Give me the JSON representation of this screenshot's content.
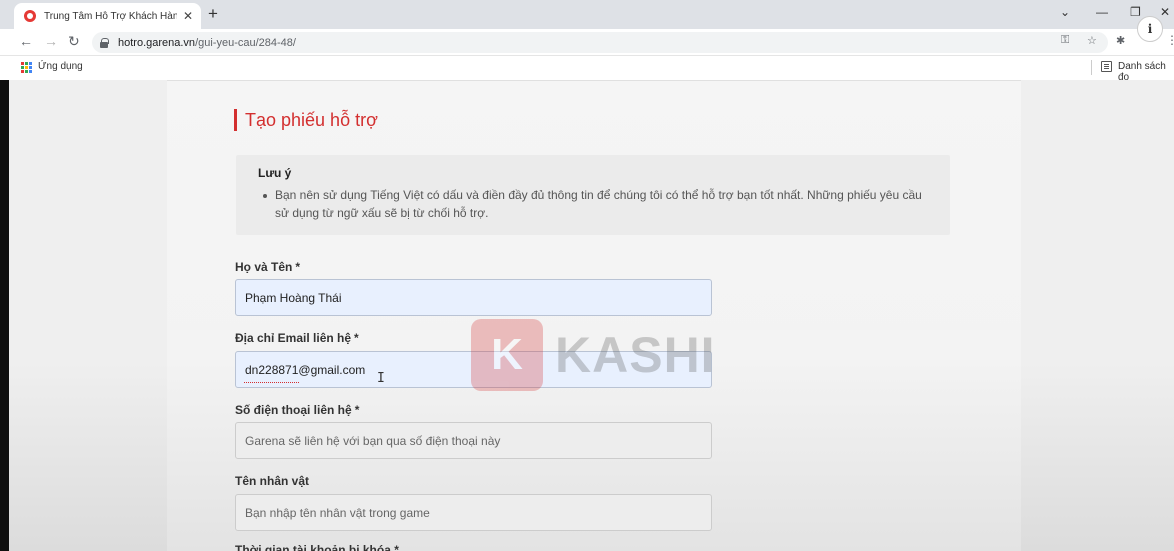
{
  "browser": {
    "tab_title": "Trung Tâm Hỗ Trợ Khách Hàng G",
    "tab_close": "✕",
    "new_tab": "+",
    "url_host": "hotro.garena.vn",
    "url_path": "/gui-yeu-cau/284-48/",
    "bookmark_apps": "Ứng dụng",
    "bookmark_reading_list": "Danh sách đọ",
    "profile_glyph": "i"
  },
  "page": {
    "title": "Tạo phiếu hỗ trợ",
    "note_title": "Lưu ý",
    "note_text": "Bạn nên sử dụng Tiếng Việt có dấu và điền đầy đủ thông tin để chúng tôi có thể hỗ trợ bạn tốt nhất. Những phiếu yêu cầu sử dụng từ ngữ xấu sẽ bị từ chối hỗ trợ.",
    "required_mark": "*",
    "fields": [
      {
        "label": "Họ và Tên",
        "required": true,
        "value": "Phạm Hoàng Thái",
        "placeholder": ""
      },
      {
        "label": "Địa chỉ Email liên hệ",
        "required": true,
        "value": "dn228871@gmail.com",
        "placeholder": ""
      },
      {
        "label": "Số điện thoại liên hệ",
        "required": true,
        "value": "",
        "placeholder": "Garena sẽ liên hệ với bạn qua số điện thoại này"
      },
      {
        "label": "Tên nhân vật",
        "required": false,
        "value": "",
        "placeholder": "Bạn nhập tên nhân vật trong game"
      }
    ],
    "next_label_cut": "Thời gian tài khoản bị khóa *"
  },
  "watermark": {
    "logo_letter": "K",
    "text": "KASHI"
  },
  "colors": {
    "accent": "#d32f2f",
    "autofill_bg": "#e8f0fe"
  }
}
